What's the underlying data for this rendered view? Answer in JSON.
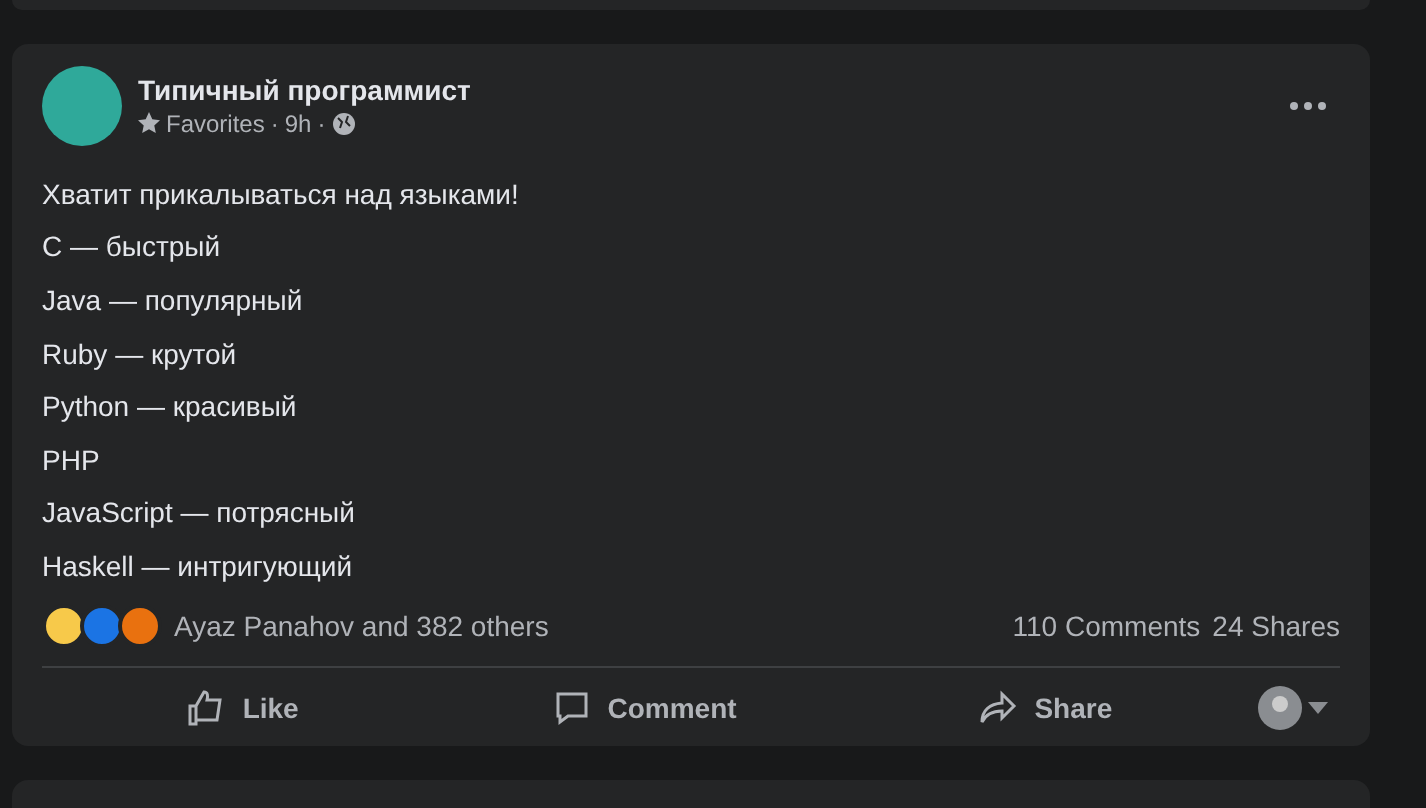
{
  "post": {
    "author": "Типичный программист",
    "audience": "Favorites",
    "time": "9h",
    "separator": "·",
    "lines": [
      "Хватит прикалываться над языками!",
      "C — быстрый",
      "Java — популярный",
      "Ruby — крутой",
      "Python — красивый",
      "PHP",
      "JavaScript — потрясный",
      "Haskell — интригующий"
    ],
    "reactions_text": "Ayaz Panahov and 382 others",
    "comments": "110 Comments",
    "shares": "24 Shares",
    "actions": [
      {
        "kind": "like",
        "label": "Like"
      },
      {
        "kind": "comment",
        "label": "Comment"
      },
      {
        "kind": "share",
        "label": "Share"
      }
    ]
  }
}
